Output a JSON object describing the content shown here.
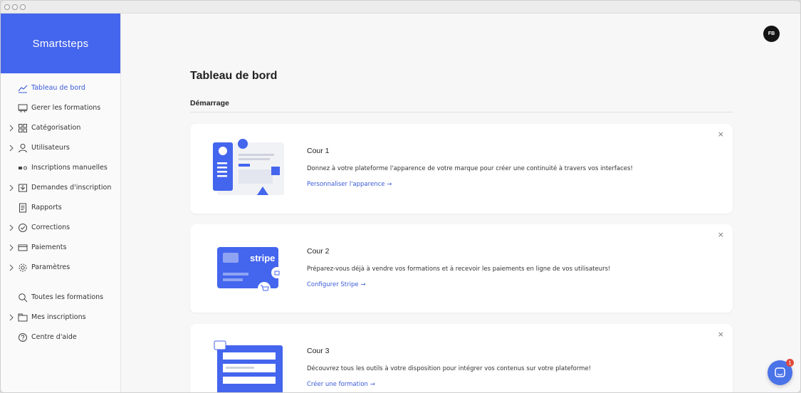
{
  "brand": {
    "name": "Smartsteps"
  },
  "user": {
    "initials": "FB"
  },
  "sidebar": {
    "items": [
      {
        "label": "Tableau de bord",
        "icon": "chart-line-icon",
        "active": true,
        "expandable": false
      },
      {
        "label": "Gerer les formations",
        "icon": "projector-icon",
        "active": false,
        "expandable": false
      },
      {
        "label": "Catégorisation",
        "icon": "grid-icon",
        "active": false,
        "expandable": true
      },
      {
        "label": "Utilisateurs",
        "icon": "user-icon",
        "active": false,
        "expandable": true
      },
      {
        "label": "Inscriptions manuelles",
        "icon": "toggle-icon",
        "active": false,
        "expandable": false
      },
      {
        "label": "Demandes d'inscription",
        "icon": "inbox-icon",
        "active": false,
        "expandable": true
      },
      {
        "label": "Rapports",
        "icon": "report-icon",
        "active": false,
        "expandable": false
      },
      {
        "label": "Corrections",
        "icon": "check-circle-icon",
        "active": false,
        "expandable": true
      },
      {
        "label": "Paiements",
        "icon": "credit-card-icon",
        "active": false,
        "expandable": true
      },
      {
        "label": "Paramètres",
        "icon": "gear-icon",
        "active": false,
        "expandable": true
      }
    ],
    "secondary": [
      {
        "label": "Toutes les formations",
        "icon": "search-icon",
        "expandable": false
      },
      {
        "label": "Mes inscriptions",
        "icon": "folder-icon",
        "expandable": true
      },
      {
        "label": "Centre d'aide",
        "icon": "help-icon",
        "expandable": false
      }
    ]
  },
  "main": {
    "title": "Tableau de bord",
    "section": "Démarrage",
    "cards": [
      {
        "title": "Cour 1",
        "description": "Donnez à votre plateforme l'apparence de votre marque pour créer une continuité à travers vos interfaces!",
        "link": "Personnaliser l'apparence",
        "illustration": "appearance-illustration"
      },
      {
        "title": "Cour 2",
        "description": "Préparez-vous déjà à vendre vos formations et à recevoir les paiements en ligne de vos utilisateurs!",
        "link": "Configurer Stripe",
        "illustration": "stripe-illustration",
        "illustration_text": "stripe"
      },
      {
        "title": "Cour 3",
        "description": "Découvrez tous les outils à votre disposition pour intégrer vos contenus sur votre plateforme!",
        "link": "Créer une formation",
        "illustration": "course-illustration"
      }
    ],
    "close_label": "×",
    "arrow": "→"
  },
  "chat": {
    "badge": "1"
  },
  "colors": {
    "accent": "#4465ed",
    "link": "#3a5ad8",
    "badge": "#e24a3b"
  }
}
